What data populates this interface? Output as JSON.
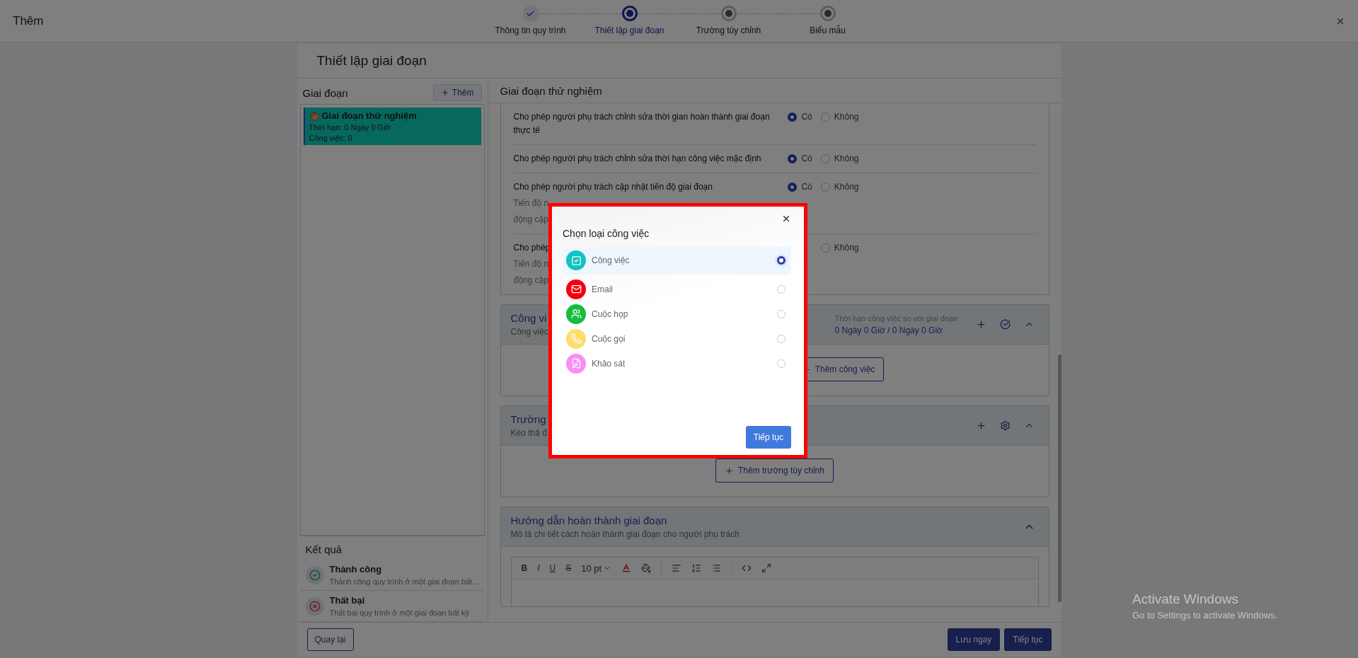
{
  "window": {
    "title": "Thêm"
  },
  "steps": [
    {
      "label": "Thông tin quy trình",
      "done": true,
      "selected": false
    },
    {
      "label": "Thiết lập giai đoạn",
      "done": false,
      "selected": true
    },
    {
      "label": "Trường tùy chỉnh",
      "done": false,
      "selected": false
    },
    {
      "label": "Biểu mẫu",
      "done": false,
      "selected": false
    }
  ],
  "card_title": "Thiết lập giai đoạn",
  "stages": {
    "title": "Giai đoạn",
    "add_button": "Thêm",
    "items": [
      {
        "name": "Giai đoạn thử nghiệm",
        "duration": "Thời hạn: 0 Ngày 0 Giờ",
        "tasks": "Công việc: 0",
        "selected": true
      }
    ]
  },
  "results": {
    "title": "Kết quả",
    "items": [
      {
        "kind": "success",
        "name": "Thành công",
        "description": "Thành công quy trình ở một giai đoạn bất..."
      },
      {
        "kind": "failure",
        "name": "Thất bại",
        "description": "Thất bại quy trình ở một giai đoạn bất kỳ"
      }
    ]
  },
  "stage_title": "Giai đoạn thử nghiệm",
  "settings": [
    {
      "label": "Cho phép người phụ trách chỉnh sửa thời gian hoàn thành giai đoạn thực tế",
      "options": [
        {
          "label": "Có",
          "selected": true
        },
        {
          "label": "Không",
          "selected": false
        }
      ]
    },
    {
      "label": "Cho phép người phụ trách chỉnh sửa thời hạn công việc mặc định",
      "options": [
        {
          "label": "Có",
          "selected": true
        },
        {
          "label": "Không",
          "selected": false
        }
      ]
    },
    {
      "label": "Cho phép người phụ trách cập nhật tiến độ giai đoạn",
      "description": [
        "Tiến độ n",
        "động cập"
      ],
      "options": [
        {
          "label": "Có",
          "selected": true
        },
        {
          "label": "Không",
          "selected": false
        }
      ]
    },
    {
      "label": "Cho phép",
      "description": [
        "Tiến độ n",
        "động cập"
      ],
      "options": [
        {
          "label": "Không",
          "selected": false
        }
      ]
    }
  ],
  "tasks_section": {
    "title": "Công vi",
    "subtitle": "Công việc",
    "deadline_label": "Thời hạn công việc so với giai đoạn",
    "deadline_value": "0 Ngày 0 Giờ / 0 Ngày 0 Giờ",
    "add_button": "Thêm công việc"
  },
  "fields_section": {
    "title": "Trường",
    "subtitle": "Kéo thả đ",
    "add_button": "Thêm trường tùy chỉnh"
  },
  "guide_section": {
    "title": "Hướng dẫn hoàn thành giai đoạn",
    "subtitle": "Mô tả chi tiết cách hoàn thành giai đoạn cho người phụ trách",
    "format_buttons": [
      "B",
      "I",
      "U",
      "S"
    ],
    "font_size": "10 pt"
  },
  "footer": {
    "back": "Quay lại",
    "save": "Lưu ngay",
    "next": "Tiếp tục"
  },
  "modal": {
    "title": "Chọn loại công việc",
    "button": "Tiếp tục",
    "options": [
      {
        "kind": "task",
        "label": "Công việc",
        "color": "#13c2c2",
        "selected": true
      },
      {
        "kind": "email",
        "label": "Email",
        "color": "#f5000f",
        "selected": false
      },
      {
        "kind": "meeting",
        "label": "Cuộc họp",
        "color": "#16bd3c",
        "selected": false
      },
      {
        "kind": "call",
        "label": "Cuộc gọi",
        "color": "#fadf6a",
        "selected": false
      },
      {
        "kind": "survey",
        "label": "Khảo sát",
        "color": "#f98cf5",
        "selected": false
      }
    ]
  },
  "os_notice": {
    "title": "Activate Windows",
    "text": "Go to Settings to activate Windows."
  }
}
